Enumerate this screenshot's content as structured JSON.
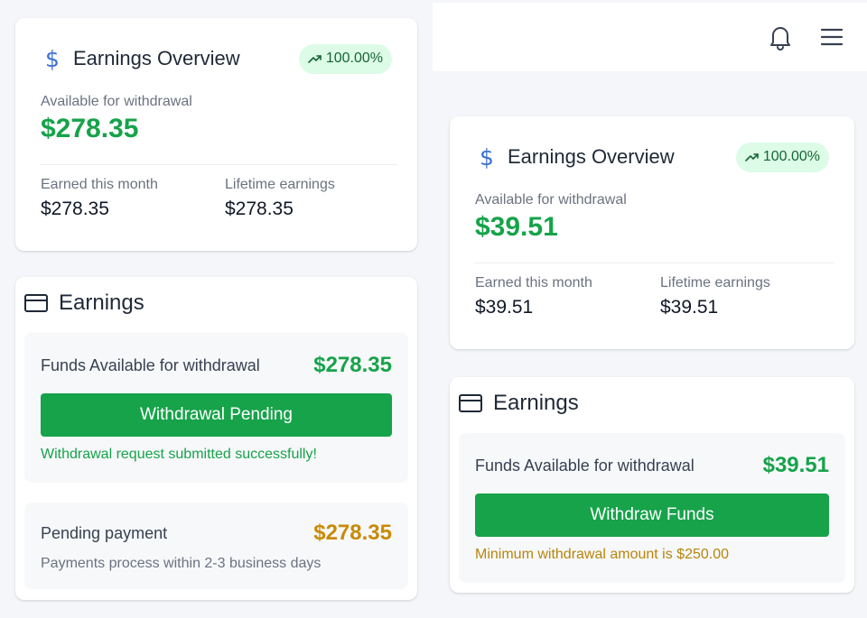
{
  "colors": {
    "accent_green": "#16a34a",
    "badge_bg": "#dcfce7",
    "warning_amber": "#ca8a04",
    "icon_blue": "#3b6fd4"
  },
  "icons": {
    "currency": "dollar-icon",
    "trend": "trending-up-icon",
    "card": "credit-card-icon",
    "notifications": "bell-icon",
    "menu": "hamburger-menu-icon"
  },
  "left": {
    "overview": {
      "title": "Earnings Overview",
      "badge": "100.00%",
      "available_label": "Available for withdrawal",
      "available_amount": "$278.35",
      "month_label": "Earned this month",
      "month_value": "$278.35",
      "lifetime_label": "Lifetime earnings",
      "lifetime_value": "$278.35"
    },
    "earnings": {
      "title": "Earnings",
      "funds_label": "Funds Available for withdrawal",
      "funds_amount": "$278.35",
      "button_label": "Withdrawal Pending",
      "status_message": "Withdrawal request submitted successfully!",
      "pending_label": "Pending payment",
      "pending_amount": "$278.35",
      "pending_note": "Payments process within 2-3 business days"
    }
  },
  "right": {
    "overview": {
      "title": "Earnings Overview",
      "badge": "100.00%",
      "available_label": "Available for withdrawal",
      "available_amount": "$39.51",
      "month_label": "Earned this month",
      "month_value": "$39.51",
      "lifetime_label": "Lifetime earnings",
      "lifetime_value": "$39.51"
    },
    "earnings": {
      "title": "Earnings",
      "funds_label": "Funds Available for withdrawal",
      "funds_amount": "$39.51",
      "button_label": "Withdraw Funds",
      "status_message": "Minimum withdrawal amount is $250.00"
    }
  }
}
